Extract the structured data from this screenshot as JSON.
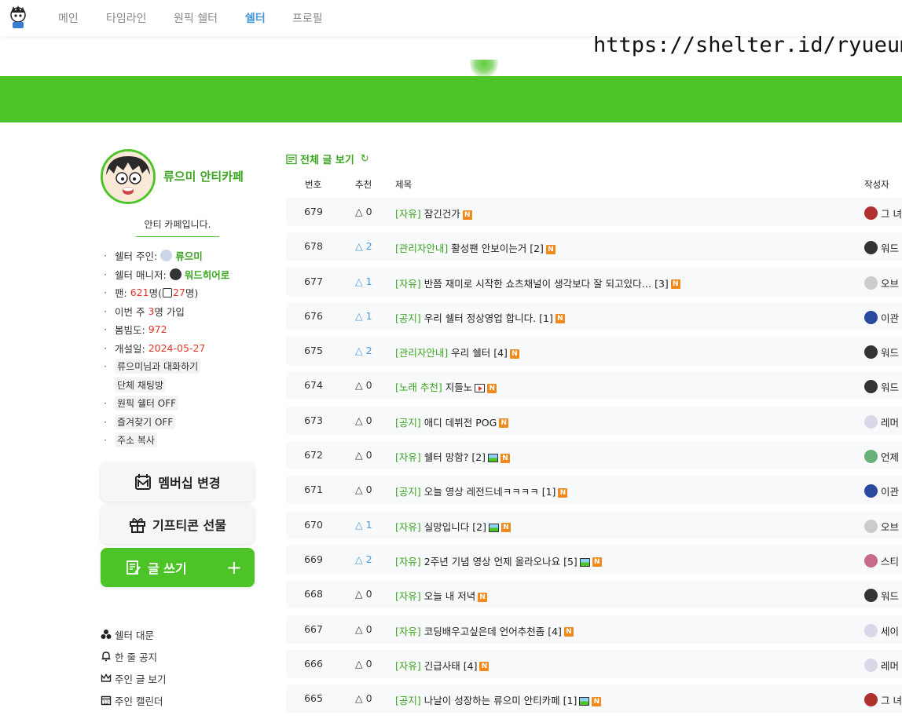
{
  "nav": {
    "items": [
      {
        "label": "메인",
        "active": false
      },
      {
        "label": "타임라인",
        "active": false
      },
      {
        "label": "원픽 쉘터",
        "active": false
      },
      {
        "label": "쉘터",
        "active": true
      },
      {
        "label": "프로필",
        "active": false
      }
    ]
  },
  "banner": {
    "url_text": "https://shelter.id/ryueumi"
  },
  "sidebar": {
    "name": "류으미 안티카페",
    "description": "안티 카페입니다.",
    "owner_label": "쉘터 주인:",
    "owner_name": "류으미",
    "manager_label": "쉘터 매니저:",
    "manager_name": "워드히어로",
    "fans_label": "팬:",
    "fans_count": "621",
    "fans_unit": "명(",
    "fans_sub": "27",
    "fans_sub_unit": "명)",
    "week_label": "이번 주",
    "week_count": "3",
    "week_unit": "명 가입",
    "bloom_label": "봄빔도:",
    "bloom_value": "972",
    "opened_label": "개설일:",
    "opened_value": "2024-05-27",
    "chat_label": "류으미님과 대화하기",
    "group_chat_label": "단체 채팅방",
    "onepick_label": "원픽 쉘터 OFF",
    "favorite_label": "즐겨찾기 OFF",
    "copy_label": "주소 복사",
    "membership_button": "멤버십 변경",
    "gift_button": "기프티콘 선물",
    "write_button": "글 쓰기",
    "write_plus": "+",
    "menu": [
      "쉘터 대문",
      "한 줄 공지",
      "주인 글 보기",
      "주인 캘린더"
    ]
  },
  "board": {
    "title": "전체 글 보기",
    "columns": {
      "num": "번호",
      "rec": "추천",
      "title": "제목",
      "author": "작성자"
    },
    "rows": [
      {
        "num": "679",
        "rec": "△ 0",
        "rec_blue": false,
        "cat": "[자유]",
        "title": "잠긴건가",
        "extra": "",
        "icon": "",
        "author": "그 녀",
        "av": "#b03030"
      },
      {
        "num": "678",
        "rec": "△ 2",
        "rec_blue": true,
        "cat": "[관리자안내]",
        "title": "활성팬 안보이는거",
        "extra": "[2]",
        "icon": "",
        "author": "워드",
        "av": "#333333"
      },
      {
        "num": "677",
        "rec": "△ 1",
        "rec_blue": true,
        "cat": "[자유]",
        "title": "반쯤 재미로 시작한 쇼츠채널이 생각보다 잘 되고있다…",
        "extra": "[3]",
        "icon": "",
        "author": "오브",
        "av": "#cccccc"
      },
      {
        "num": "676",
        "rec": "△ 1",
        "rec_blue": true,
        "cat": "[공지]",
        "title": "우리 쉘터 정상영업 합니다.",
        "extra": "[1]",
        "icon": "",
        "author": "이관",
        "av": "#2a4aa0"
      },
      {
        "num": "675",
        "rec": "△ 2",
        "rec_blue": true,
        "cat": "[관리자안내]",
        "title": "우리 쉘터",
        "extra": "[4]",
        "icon": "",
        "author": "워드",
        "av": "#333333"
      },
      {
        "num": "674",
        "rec": "△ 0",
        "rec_blue": false,
        "cat": "[노래 추천]",
        "title": "지들노",
        "extra": "",
        "icon": "video",
        "author": "워드",
        "av": "#333333"
      },
      {
        "num": "673",
        "rec": "△ 0",
        "rec_blue": false,
        "cat": "[공지]",
        "title": "애디 데뷔전 POG",
        "extra": "",
        "icon": "",
        "author": "레머",
        "av": "#d8d8e8"
      },
      {
        "num": "672",
        "rec": "△ 0",
        "rec_blue": false,
        "cat": "[자유]",
        "title": "쉘터 망함?",
        "extra": "[2]",
        "icon": "image",
        "author": "언제",
        "av": "#6ab07a"
      },
      {
        "num": "671",
        "rec": "△ 0",
        "rec_blue": false,
        "cat": "[공지]",
        "title": "오늘 영상 레전드네ㅋㅋㅋㅋ",
        "extra": "[1]",
        "icon": "",
        "author": "이관",
        "av": "#2a4aa0"
      },
      {
        "num": "670",
        "rec": "△ 1",
        "rec_blue": true,
        "cat": "[자유]",
        "title": "실망입니다",
        "extra": "[2]",
        "icon": "image",
        "author": "오브",
        "av": "#cccccc"
      },
      {
        "num": "669",
        "rec": "△ 2",
        "rec_blue": true,
        "cat": "[자유]",
        "title": "2주년 기념 영상 언제 올라오나요",
        "extra": "[5]",
        "icon": "image",
        "author": "스티",
        "av": "#c86a8a"
      },
      {
        "num": "668",
        "rec": "△ 0",
        "rec_blue": false,
        "cat": "[자유]",
        "title": "오늘 내 저녁",
        "extra": "",
        "icon": "",
        "author": "워드",
        "av": "#333333"
      },
      {
        "num": "667",
        "rec": "△ 0",
        "rec_blue": false,
        "cat": "[자유]",
        "title": "코딩배우고싶은데 언어추천좀",
        "extra": "[4]",
        "icon": "",
        "author": "세이",
        "av": "#d8d8e8"
      },
      {
        "num": "666",
        "rec": "△ 0",
        "rec_blue": false,
        "cat": "[자유]",
        "title": "긴급사태",
        "extra": "[4]",
        "icon": "",
        "author": "레머",
        "av": "#d8d8e8"
      },
      {
        "num": "665",
        "rec": "△ 0",
        "rec_blue": false,
        "cat": "[공지]",
        "title": "나날이 성장하는 류으미 안티카페",
        "extra": "[1]",
        "icon": "image",
        "author": "그 녀",
        "av": "#b03030"
      }
    ],
    "new_badge": "N"
  },
  "colors": {
    "accent_green": "#4cc427",
    "text_green": "#3aa520",
    "nav_active": "#4a9ad8",
    "red": "#e0362c",
    "badge_orange": "#f08a1c"
  }
}
